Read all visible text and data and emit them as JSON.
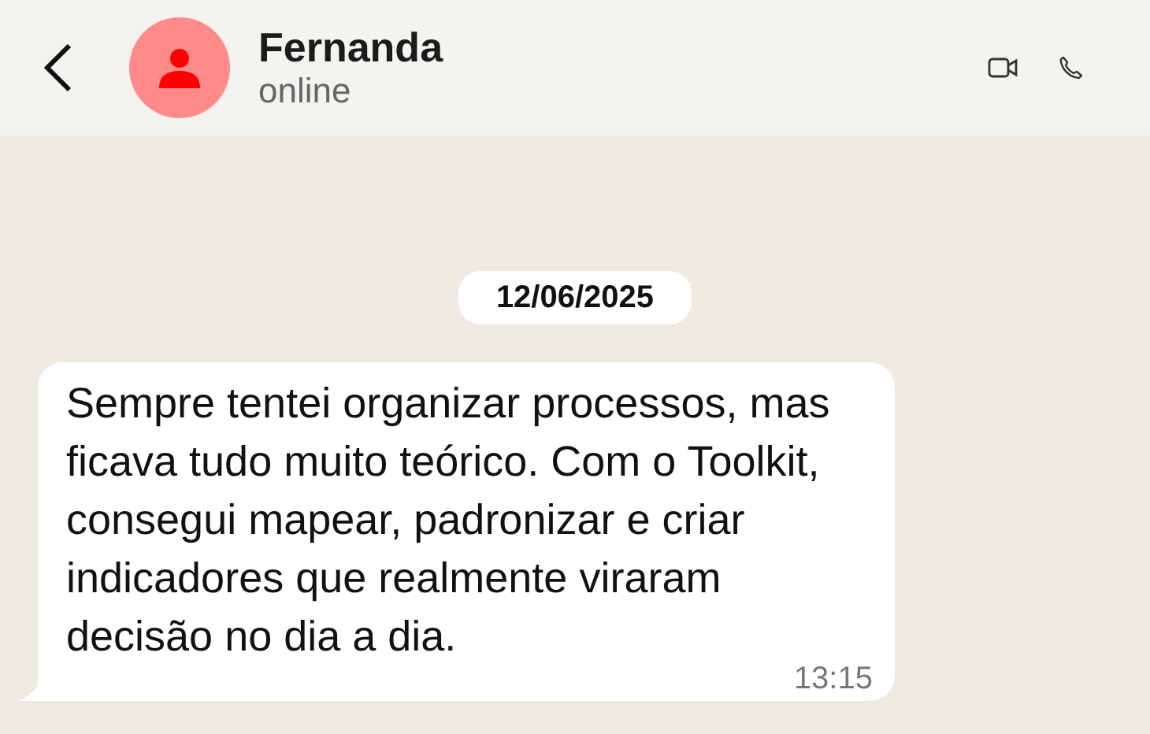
{
  "contact": {
    "name": "Fernanda",
    "status": "online"
  },
  "date_separator": "12/06/2025",
  "messages": [
    {
      "text": "Sempre tentei organizar processos, mas ficava tudo muito teórico. Com o Toolkit, consegui mapear, padronizar e criar indicadores que realmente viraram decisão no dia a dia.",
      "time": "13:15",
      "kind": "incoming"
    }
  ]
}
